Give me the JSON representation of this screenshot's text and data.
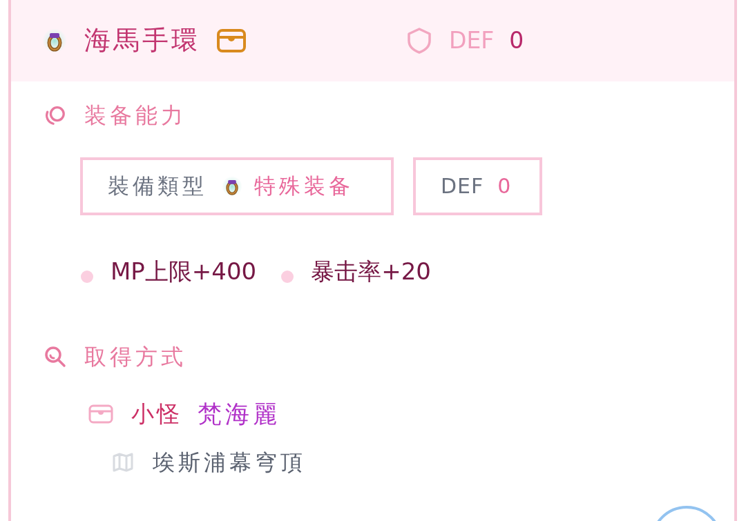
{
  "header": {
    "title": "海馬手環",
    "stat_label": "DEF",
    "stat_value": "0"
  },
  "sections": [
    {
      "kind": "abilities",
      "title": "装备能力",
      "type_label": "裝備類型",
      "type_value": "特殊装备",
      "stat_label": "DEF",
      "stat_value": "0",
      "bonuses": [
        "MP上限+400",
        "暴击率+20"
      ]
    },
    {
      "kind": "sources",
      "title": "取得方式",
      "sources": [
        {
          "category": "小怪",
          "name": "梵海麗",
          "location": "埃斯浦幕穹頂"
        }
      ]
    }
  ]
}
